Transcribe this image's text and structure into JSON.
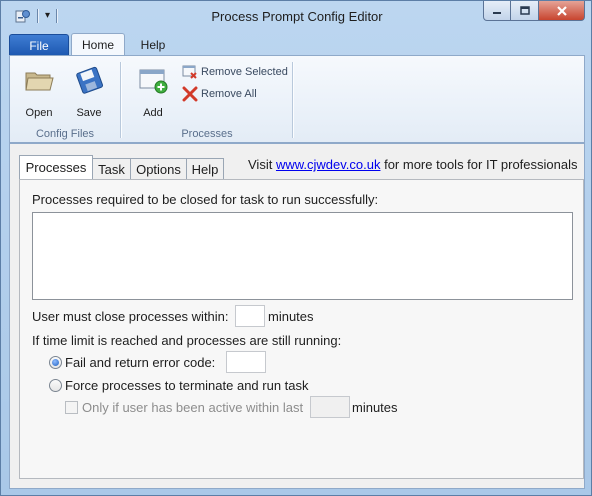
{
  "window": {
    "title": "Process Prompt Config Editor"
  },
  "quick_access": {
    "dropdown_glyph": "▾"
  },
  "ribbon": {
    "tabs": [
      {
        "label": "File"
      },
      {
        "label": "Home"
      },
      {
        "label": "Help"
      }
    ],
    "groups": {
      "config_files": {
        "label": "Config Files",
        "open_label": "Open",
        "save_label": "Save"
      },
      "processes": {
        "label": "Processes",
        "add_label": "Add",
        "remove_selected_label": "Remove Selected",
        "remove_all_label": "Remove All"
      }
    }
  },
  "tabs": [
    {
      "label": "Processes",
      "active": true
    },
    {
      "label": "Task"
    },
    {
      "label": "Options"
    },
    {
      "label": "Help"
    }
  ],
  "visit": {
    "prefix": "Visit",
    "link": "www.cjwdev.co.uk",
    "suffix": "for more tools for IT professionals"
  },
  "processes_panel": {
    "list_label": "Processes required to be closed for task to run successfully:",
    "close_within_label": "User must close processes within:",
    "close_within_value": "",
    "minutes_label": "minutes",
    "time_limit_label": "If time limit is reached and processes are still running:",
    "option_fail_label": "Fail and return error code:",
    "option_fail_checked": true,
    "error_code_value": "",
    "option_force_label": "Force processes to terminate and run task",
    "option_force_checked": false,
    "only_if_active_label": "Only if user has been active within last",
    "only_if_active_value": "",
    "only_if_active_minutes_label": "minutes"
  },
  "colors": {
    "file_tab": "#1c57b0",
    "link": "#0000ee",
    "close_button": "#c8452f"
  }
}
